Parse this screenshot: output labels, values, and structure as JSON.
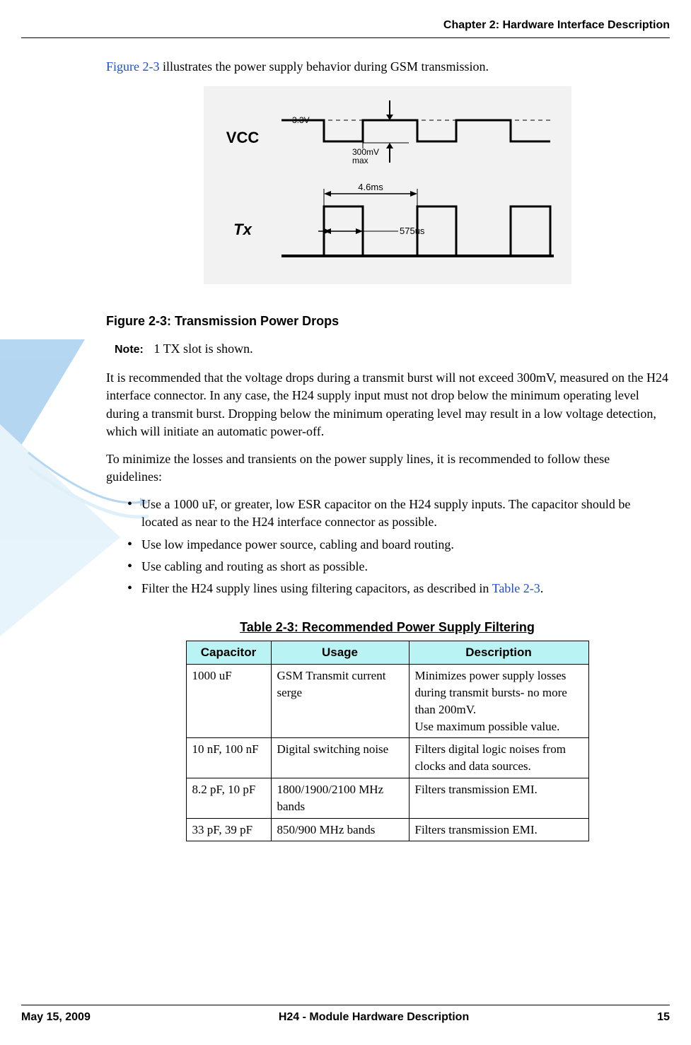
{
  "header": {
    "chapter": "Chapter 2:  Hardware Interface Description"
  },
  "intro": {
    "figref": "Figure 2-3",
    "rest": " illustrates the power supply behavior during GSM transmission."
  },
  "diagram": {
    "vcc_label": "VCC",
    "vcc_level": "3.3V",
    "vcc_drop": "300mV\nmax",
    "tx_label": "Tx",
    "tx_period": "4.6ms",
    "tx_pulse": "575us"
  },
  "fig_caption": "Figure 2-3: Transmission Power Drops",
  "note": {
    "label": "Note:",
    "text": "1 TX slot is shown."
  },
  "para1": "It is recommended that the voltage drops during a transmit burst will not exceed 300mV, measured on the H24 interface connector. In any case, the H24 supply input must not drop below the minimum operating level during a transmit burst. Dropping below the minimum operating level may result in a low voltage detection, which will initiate an automatic power-off.",
  "para2": "To minimize the losses and transients on the power supply lines, it is recommended to follow these guidelines:",
  "bullets": [
    "Use a 1000 uF, or greater, low ESR capacitor on the H24 supply inputs. The capacitor should be located as near to the H24 interface connector as possible.",
    "Use low impedance power source, cabling and board routing.",
    "Use cabling and routing as short as possible."
  ],
  "bullet4": {
    "pre": "Filter the H24 supply lines using filtering capacitors, as described in ",
    "ref": "Table 2-3",
    "post": "."
  },
  "table": {
    "caption": "Table 2-3: Recommended Power Supply Filtering",
    "headers": [
      "Capacitor",
      "Usage",
      "Description"
    ],
    "rows": [
      {
        "cap": "1000 uF",
        "usage": "GSM Transmit current serge",
        "desc": "Minimizes power supply losses during transmit bursts- no more than 200mV.\nUse maximum possible value."
      },
      {
        "cap": "10 nF, 100 nF",
        "usage": "Digital switching noise",
        "desc": "Filters digital logic noises from clocks and data sources."
      },
      {
        "cap": "8.2 pF, 10 pF",
        "usage": "1800/1900/2100 MHz bands",
        "desc": "Filters transmission EMI."
      },
      {
        "cap": "33 pF, 39 pF",
        "usage": "850/900 MHz bands",
        "desc": "Filters transmission EMI."
      }
    ]
  },
  "footer": {
    "date": "May 15, 2009",
    "title": "H24 - Module Hardware Description",
    "page": "15"
  }
}
